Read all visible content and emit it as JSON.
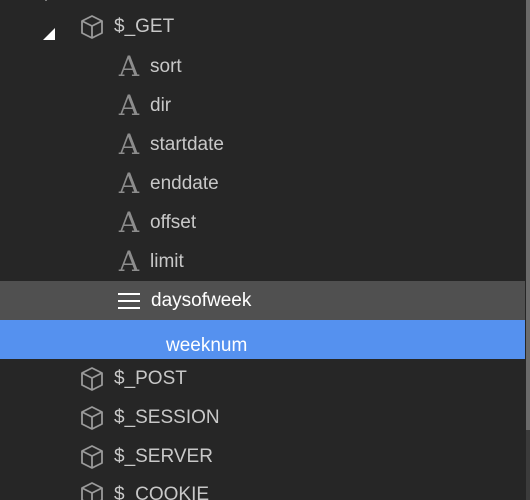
{
  "tree": {
    "group": {
      "label": "$_GET",
      "icon": "cube-icon",
      "expanded": true
    },
    "children": [
      {
        "label": "sort",
        "icon": "text-type-icon"
      },
      {
        "label": "dir",
        "icon": "text-type-icon"
      },
      {
        "label": "startdate",
        "icon": "text-type-icon"
      },
      {
        "label": "enddate",
        "icon": "text-type-icon"
      },
      {
        "label": "offset",
        "icon": "text-type-icon"
      },
      {
        "label": "limit",
        "icon": "text-type-icon"
      },
      {
        "label": "daysofweek",
        "icon": "list-icon"
      },
      {
        "label": "weeknum",
        "icon": "none"
      }
    ],
    "siblings": [
      {
        "label": "$_POST",
        "icon": "cube-icon"
      },
      {
        "label": "$_SESSION",
        "icon": "cube-icon"
      },
      {
        "label": "$_SERVER",
        "icon": "cube-icon"
      },
      {
        "label": "$_COOKIE",
        "icon": "cube-icon"
      }
    ]
  },
  "colors": {
    "background": "#262626",
    "hover_row": "#505050",
    "selected_row": "#5591ef",
    "text": "#c8c8c8",
    "icon": "#8d8d8d"
  }
}
